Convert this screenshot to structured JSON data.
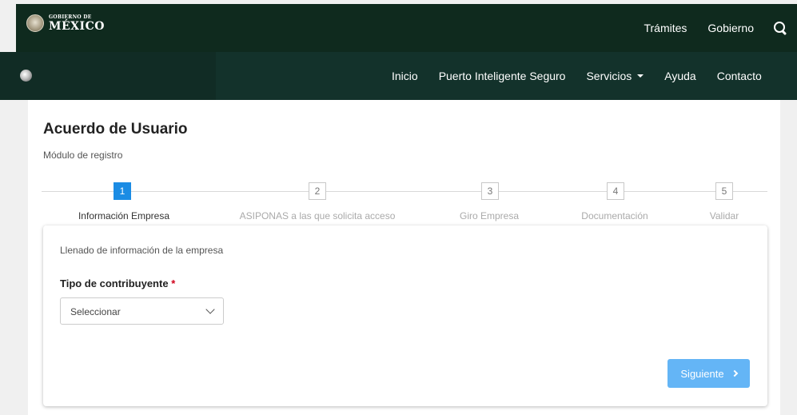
{
  "gov_header": {
    "logo_small": "GOBIERNO DE",
    "logo_big": "MÉXICO",
    "links": [
      "Trámites",
      "Gobierno"
    ],
    "search_icon": "search-icon"
  },
  "nav": {
    "items": [
      "Inicio",
      "Puerto Inteligente Seguro",
      "Servicios",
      "Ayuda",
      "Contacto"
    ]
  },
  "page": {
    "title": "Acuerdo de Usuario",
    "subtitle": "Módulo de registro"
  },
  "stepper": {
    "current_step": 1,
    "steps": [
      {
        "number": "1",
        "label": "Información Empresa"
      },
      {
        "number": "2",
        "label": "ASIPONAS a las que solicita acceso"
      },
      {
        "number": "3",
        "label": "Giro Empresa"
      },
      {
        "number": "4",
        "label": "Documentación"
      },
      {
        "number": "5",
        "label": "Validar"
      }
    ]
  },
  "form": {
    "description": "Llenado de información de la empresa",
    "field_label": "Tipo de contribuyente",
    "required_mark": "*",
    "select_value": "Seleccionar",
    "next_label": "Siguiente"
  },
  "colors": {
    "gov_bar": "#0f2a1e",
    "nav_bar": "#13322b",
    "active_step": "#1b8ce4",
    "next_button": "#64b5f6",
    "required": "#d0021b"
  }
}
